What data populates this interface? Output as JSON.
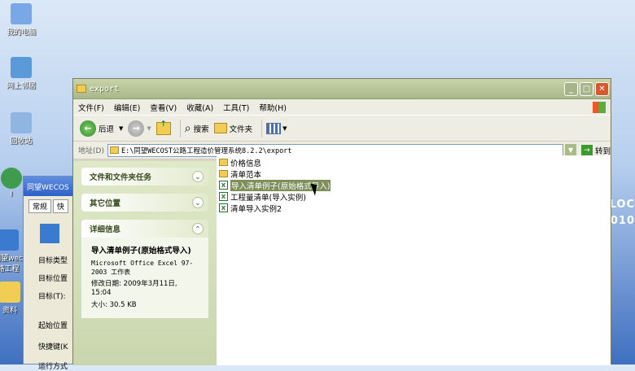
{
  "desktop": {
    "icons": [
      {
        "label": "我的电脑",
        "color": "#7aa7e6"
      },
      {
        "label": "网上邻居",
        "color": "#5a9ad8"
      },
      {
        "label": "回收站",
        "color": "#8fb5e0"
      },
      {
        "label": "I",
        "color": "#3f9b4d"
      },
      {
        "label": "同望wec\n路工程",
        "color": "#3a7bd0"
      },
      {
        "label": "资料",
        "color": "#f2cd55"
      }
    ],
    "bg_text_1": "OLOC",
    "bg_text_2": "010"
  },
  "props_window": {
    "title": "同望WECOS",
    "tab1": "常规",
    "tab2": "快",
    "rows": [
      "目标类型",
      "目标位置",
      "目标(T):",
      "起始位置",
      "快捷键(K",
      "运行方式"
    ]
  },
  "window": {
    "title": "export",
    "menu": [
      "文件(F)",
      "编辑(E)",
      "查看(V)",
      "收藏(A)",
      "工具(T)",
      "帮助(H)"
    ],
    "toolbar": {
      "back": "后退",
      "search": "搜索",
      "folders": "文件夹"
    },
    "address": {
      "label": "地址(D)",
      "path": "E:\\同望WECOST公路工程造价管理系统8.2.2\\export",
      "go": "转到"
    },
    "panels": {
      "tasks": "文件和文件夹任务",
      "other": "其它位置",
      "details": {
        "title": "详细信息",
        "name": "导入清单例子(原始格式导入)",
        "type": "Microsoft Office Excel 97-2003 工作表",
        "modified": "修改日期: 2009年3月11日, 15:04",
        "size": "大小: 30.5 KB"
      }
    },
    "files": [
      {
        "name": "价格信息",
        "kind": "folder"
      },
      {
        "name": "清单范本",
        "kind": "folder"
      },
      {
        "name": "导入清单例子(原始格式导入)",
        "kind": "excel",
        "selected": true
      },
      {
        "name": "工程量清单(导入实例)",
        "kind": "excel"
      },
      {
        "name": "清单导入实例2",
        "kind": "excel"
      }
    ]
  }
}
